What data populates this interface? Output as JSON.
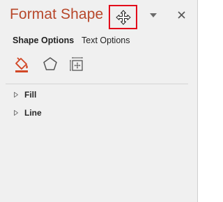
{
  "pane": {
    "title": "Format Shape",
    "move_icon": "move-cross-arrows-icon",
    "menu_icon": "dropdown-triangle-icon",
    "close_icon": "close-x-icon",
    "close_label": "×"
  },
  "tabs": [
    {
      "label": "Shape Options",
      "active": true
    },
    {
      "label": "Text Options",
      "active": false
    }
  ],
  "category_icons": [
    "fill-line-bucket-icon",
    "effects-pentagon-icon",
    "size-properties-icon"
  ],
  "sections": [
    {
      "label": "Fill",
      "expanded": false
    },
    {
      "label": "Line",
      "expanded": false
    }
  ],
  "colors": {
    "title": "#b7472a",
    "selected_icon": "#d24726",
    "highlight_box": "#e3071a"
  }
}
